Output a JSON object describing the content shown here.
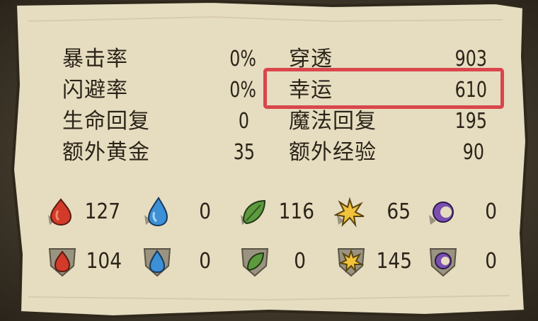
{
  "left_stats": [
    {
      "label": "暴击率",
      "value": "0%"
    },
    {
      "label": "闪避率",
      "value": "0%"
    },
    {
      "label": "生命回复",
      "value": "0"
    },
    {
      "label": "额外黄金",
      "value": "35"
    }
  ],
  "right_stats": [
    {
      "label": "穿透",
      "value": "903"
    },
    {
      "label": "幸运",
      "value": "610"
    },
    {
      "label": "魔法回复",
      "value": "195"
    },
    {
      "label": "额外经验",
      "value": "90"
    }
  ],
  "highlighted_stat": "幸运",
  "colors": {
    "highlight": "#d9464b",
    "parchment": "#e6dcc0",
    "text": "#2b2418",
    "fire": "#d23a2a",
    "water": "#3d8fd6",
    "earth": "#5d9a3e",
    "light": "#f2c23a",
    "dark": "#7a4fb0"
  },
  "resource_rows": [
    {
      "row": "attack",
      "items": [
        {
          "icon": "fire-drop-icon",
          "value": "127"
        },
        {
          "icon": "water-drop-icon",
          "value": "0"
        },
        {
          "icon": "leaf-icon",
          "value": "116"
        },
        {
          "icon": "star-burst-icon",
          "value": "65"
        },
        {
          "icon": "dark-orb-icon",
          "value": "0"
        }
      ]
    },
    {
      "row": "defense",
      "items": [
        {
          "icon": "fire-drop-icon",
          "value": "104"
        },
        {
          "icon": "water-drop-icon",
          "value": "0"
        },
        {
          "icon": "leaf-icon",
          "value": "0"
        },
        {
          "icon": "star-burst-icon",
          "value": "145"
        },
        {
          "icon": "dark-orb-icon",
          "value": "0"
        }
      ]
    }
  ]
}
